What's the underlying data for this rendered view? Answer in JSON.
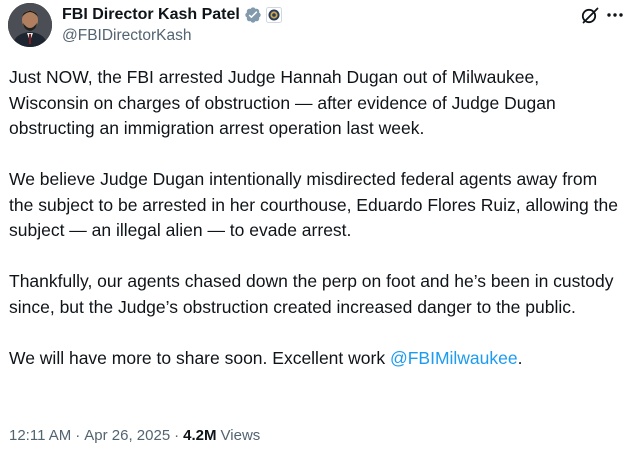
{
  "author": {
    "display_name": "FBI Director Kash Patel",
    "handle": "@FBIDirectorKash",
    "verified_color": "#829aab",
    "affiliation_badge": "fbi-seal-icon"
  },
  "actions": {
    "grok_icon": "grok-icon",
    "more_icon": "more-icon"
  },
  "tweet": {
    "paragraphs": [
      "Just NOW, the FBI arrested Judge Hannah Dugan out of Milwaukee, Wisconsin on charges of obstruction — after evidence of Judge Dugan obstructing an immigration arrest operation last week.",
      "We believe Judge Dugan intentionally misdirected federal agents away from the subject to be arrested in her courthouse, Eduardo Flores Ruiz, allowing the subject — an illegal alien — to evade arrest.",
      "Thankfully, our agents chased down the perp on foot and he’s been in custody since, but the Judge’s obstruction created increased danger to the public."
    ],
    "last_paragraph_prefix": "We will have more to share soon. Excellent work ",
    "mention": "@FBIMilwaukee",
    "last_paragraph_suffix": "."
  },
  "meta": {
    "time": "12:11 AM",
    "date": "Apr 26, 2025",
    "separator": "·",
    "views_count": "4.2M",
    "views_label": "Views"
  },
  "colors": {
    "text": "#0f1419",
    "secondary": "#536471",
    "link": "#1d9bf0"
  }
}
